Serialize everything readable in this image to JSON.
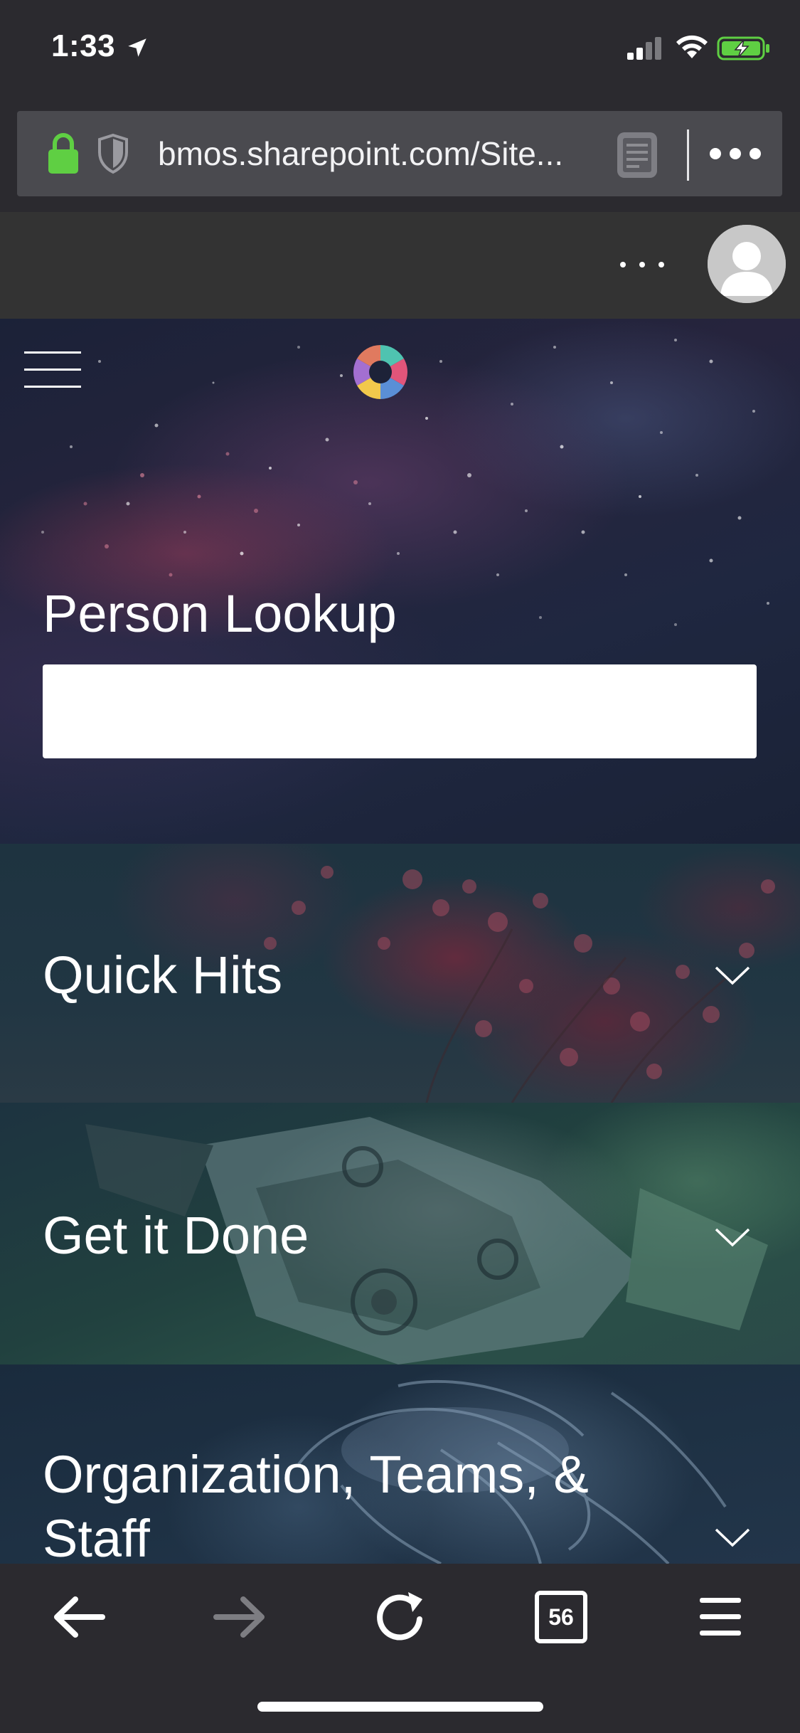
{
  "status_bar": {
    "time": "1:33"
  },
  "browser": {
    "url_display": "bmos.sharepoint.com/Site...",
    "tab_count": "56"
  },
  "hero": {
    "title": "Person Lookup",
    "search_value": ""
  },
  "sections": [
    {
      "title": "Quick Hits",
      "expanded": false
    },
    {
      "title": "Get it Done",
      "expanded": false
    },
    {
      "title": "Organization, Teams, & Staff",
      "expanded": false
    }
  ],
  "icons": {
    "status": [
      "location-arrow-icon",
      "signal-icon",
      "wifi-icon",
      "battery-charging-icon"
    ],
    "url_bar": [
      "lock-icon",
      "tracking-shield-icon",
      "reader-view-icon",
      "page-actions-icon"
    ],
    "suite_bar": [
      "more-icon",
      "avatar"
    ],
    "hero": [
      "hamburger-icon",
      "site-logo"
    ],
    "toolbar": [
      "back-arrow-icon",
      "forward-arrow-icon",
      "reload-icon",
      "tabs-icon",
      "menu-icon"
    ]
  },
  "colors": {
    "lock_green": "#5fcf43",
    "battery_green": "#5fcf43",
    "browser_chrome": "#2b2a2f",
    "url_field": "#4a4a4f",
    "suite_bar": "#333333",
    "disabled_arrow": "#7d7d82"
  }
}
